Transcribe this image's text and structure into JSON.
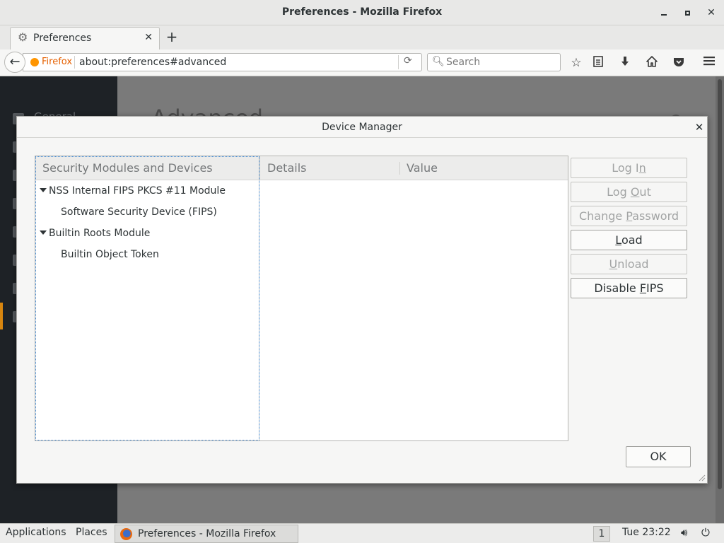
{
  "window": {
    "title": "Preferences - Mozilla Firefox"
  },
  "tabs": [
    {
      "label": "Preferences",
      "icon": "gear-icon",
      "active": true
    }
  ],
  "navbar": {
    "identity_label": "Firefox",
    "url": "about:preferences#advanced",
    "search_placeholder": "Search"
  },
  "page": {
    "heading": "Advanced",
    "sidebar_first_item": "General"
  },
  "dialog": {
    "title": "Device Manager",
    "columns": {
      "modules": "Security Modules and Devices",
      "details": "Details",
      "value": "Value"
    },
    "tree": [
      {
        "label": "NSS Internal FIPS PKCS #11 Module",
        "level": 0,
        "expanded": true
      },
      {
        "label": "Software Security Device (FIPS)",
        "level": 1
      },
      {
        "label": "Builtin Roots Module",
        "level": 0,
        "expanded": true
      },
      {
        "label": "Builtin Object Token",
        "level": 1
      }
    ],
    "buttons": {
      "login": {
        "pre": "Log I",
        "acc": "n",
        "post": "",
        "enabled": false
      },
      "logout": {
        "pre": "Log ",
        "acc": "O",
        "post": "ut",
        "enabled": false
      },
      "change_password": {
        "pre": "Change ",
        "acc": "P",
        "post": "assword",
        "enabled": false
      },
      "load": {
        "pre": "",
        "acc": "L",
        "post": "oad",
        "enabled": true
      },
      "unload": {
        "pre": "",
        "acc": "U",
        "post": "nload",
        "enabled": false
      },
      "disable_fips": {
        "pre": "Disable ",
        "acc": "F",
        "post": "IPS",
        "enabled": true
      }
    },
    "ok_label": "OK"
  },
  "panel": {
    "applications": "Applications",
    "places": "Places",
    "task": "Preferences - Mozilla Firefox",
    "workspace": "1",
    "clock": "Tue 23:22"
  },
  "colors": {
    "accent_orange": "#e66000",
    "sidebar_dark": "#1e2226",
    "selection_marker": "#d8860f"
  }
}
